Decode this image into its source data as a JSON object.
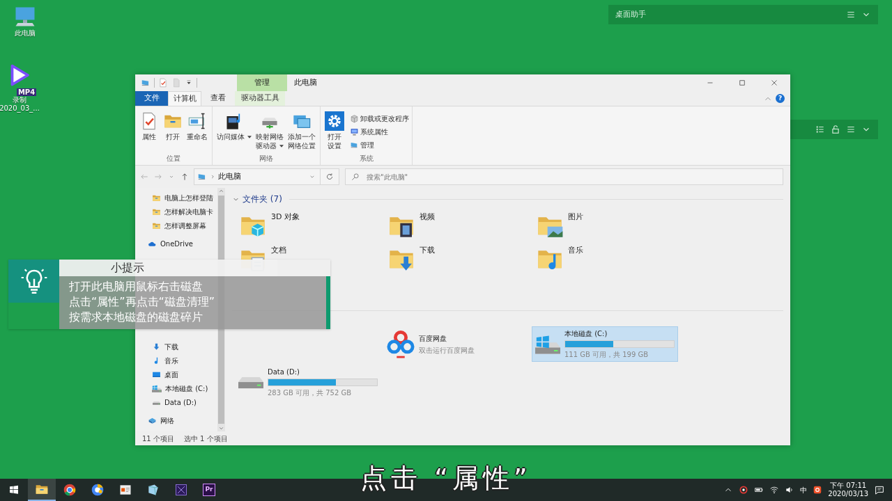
{
  "desktop_icons": [
    {
      "kind": "computer",
      "label": "此电脑"
    },
    {
      "kind": "video",
      "badge": "MP4",
      "label": "录制",
      "sublabel": "2020_03_..."
    }
  ],
  "helper_panels": [
    {
      "title": "桌面助手",
      "tools": [
        {
          "kind": "menu"
        },
        {
          "kind": "chevron"
        }
      ]
    },
    {
      "tools": [
        {
          "kind": "list"
        },
        {
          "kind": "lock"
        },
        {
          "kind": "menu"
        },
        {
          "kind": "chevron"
        }
      ]
    }
  ],
  "window": {
    "title": "此电脑",
    "context_tab": "管理",
    "help": "?"
  },
  "ribbon_tabs": [
    {
      "label": "文件",
      "kind": "file",
      "selected": false
    },
    {
      "label": "计算机",
      "kind": "normal",
      "selected": true
    },
    {
      "label": "查看",
      "kind": "normal",
      "selected": false
    },
    {
      "label": "驱动器工具",
      "kind": "context",
      "selected": false
    }
  ],
  "ribbon_groups": [
    {
      "label": "位置",
      "buttons": [
        {
          "kind": "properties",
          "lines": [
            "属性"
          ]
        },
        {
          "kind": "open",
          "lines": [
            "打开"
          ]
        },
        {
          "kind": "rename",
          "lines": [
            "重命名"
          ]
        }
      ]
    },
    {
      "label": "网络",
      "buttons": [
        {
          "kind": "media",
          "lines": [
            "访问媒体"
          ],
          "dropdown": true
        },
        {
          "kind": "map_drive",
          "lines": [
            "映射网络",
            "驱动器"
          ],
          "dropdown": true
        },
        {
          "kind": "add_location",
          "lines": [
            "添加一个",
            "网络位置"
          ]
        }
      ]
    },
    {
      "label": "系统",
      "buttons": [
        {
          "kind": "settings",
          "lines": [
            "打开",
            "设置"
          ]
        }
      ],
      "small_buttons": [
        {
          "kind": "uninstall",
          "label": "卸载或更改程序"
        },
        {
          "kind": "system_properties",
          "label": "系统属性"
        },
        {
          "kind": "manage",
          "label": "管理"
        }
      ]
    }
  ],
  "address_bar": {
    "path": "此电脑"
  },
  "search": {
    "placeholder": "搜索\"此电脑\""
  },
  "nav_items": [
    {
      "kind": "folder",
      "label": "电脑上怎样登陆"
    },
    {
      "kind": "folder",
      "label": "怎样解决电脑卡"
    },
    {
      "kind": "folder",
      "label": "怎样调整屏幕"
    },
    {
      "kind": "cloud",
      "label": "OneDrive"
    },
    {
      "kind": "downloads",
      "label": "下载"
    },
    {
      "kind": "music",
      "label": "音乐"
    },
    {
      "kind": "desktop",
      "label": "桌面"
    },
    {
      "kind": "drive_c",
      "label": "本地磁盘 (C:)"
    },
    {
      "kind": "drive",
      "label": "Data (D:)"
    },
    {
      "kind": "network",
      "label": "网络"
    }
  ],
  "folders": {
    "title": "文件夹 (7)",
    "expanded": true,
    "items": [
      {
        "kind": "cube",
        "label": "3D 对象"
      },
      {
        "kind": "video",
        "label": "视频"
      },
      {
        "kind": "pictures",
        "label": "图片"
      },
      {
        "kind": "documents",
        "label": "文档"
      },
      {
        "kind": "downloads",
        "label": "下载"
      },
      {
        "kind": "music",
        "label": "音乐"
      }
    ]
  },
  "drives": {
    "items": [
      {
        "kind": "app",
        "label": "百度网盘",
        "detail": "双击运行百度网盘",
        "selected": false
      },
      {
        "kind": "drive_c",
        "label": "本地磁盘 (C:)",
        "level": 0.44,
        "detail": "111 GB 可用，共 199 GB",
        "selected": true
      },
      {
        "kind": "drive",
        "label": "Data (D:)",
        "level": 0.62,
        "detail": "283 GB 可用，共 752 GB",
        "selected": false
      }
    ]
  },
  "status_bar": [
    "11 个项目",
    "选中 1 个项目"
  ],
  "tip": {
    "title": "小提示",
    "lines": [
      "打开此电脑用鼠标右击磁盘",
      "点击“属性”再点击“磁盘清理”",
      "按需求本地磁盘的磁盘碎片"
    ]
  },
  "subtitle": "点击  “属性”",
  "taskbar": {
    "apps": [
      {
        "kind": "explorer",
        "selected": true
      },
      {
        "kind": "chrome",
        "selected": false
      },
      {
        "kind": "chrome_blue",
        "selected": false
      },
      {
        "kind": "slides",
        "selected": false
      },
      {
        "kind": "gem",
        "selected": false
      },
      {
        "kind": "purple",
        "selected": false
      },
      {
        "kind": "premiere",
        "label": "Pr",
        "selected": false
      }
    ],
    "ime": "中",
    "time": "下午 07:11",
    "date": "2020/03/13"
  }
}
